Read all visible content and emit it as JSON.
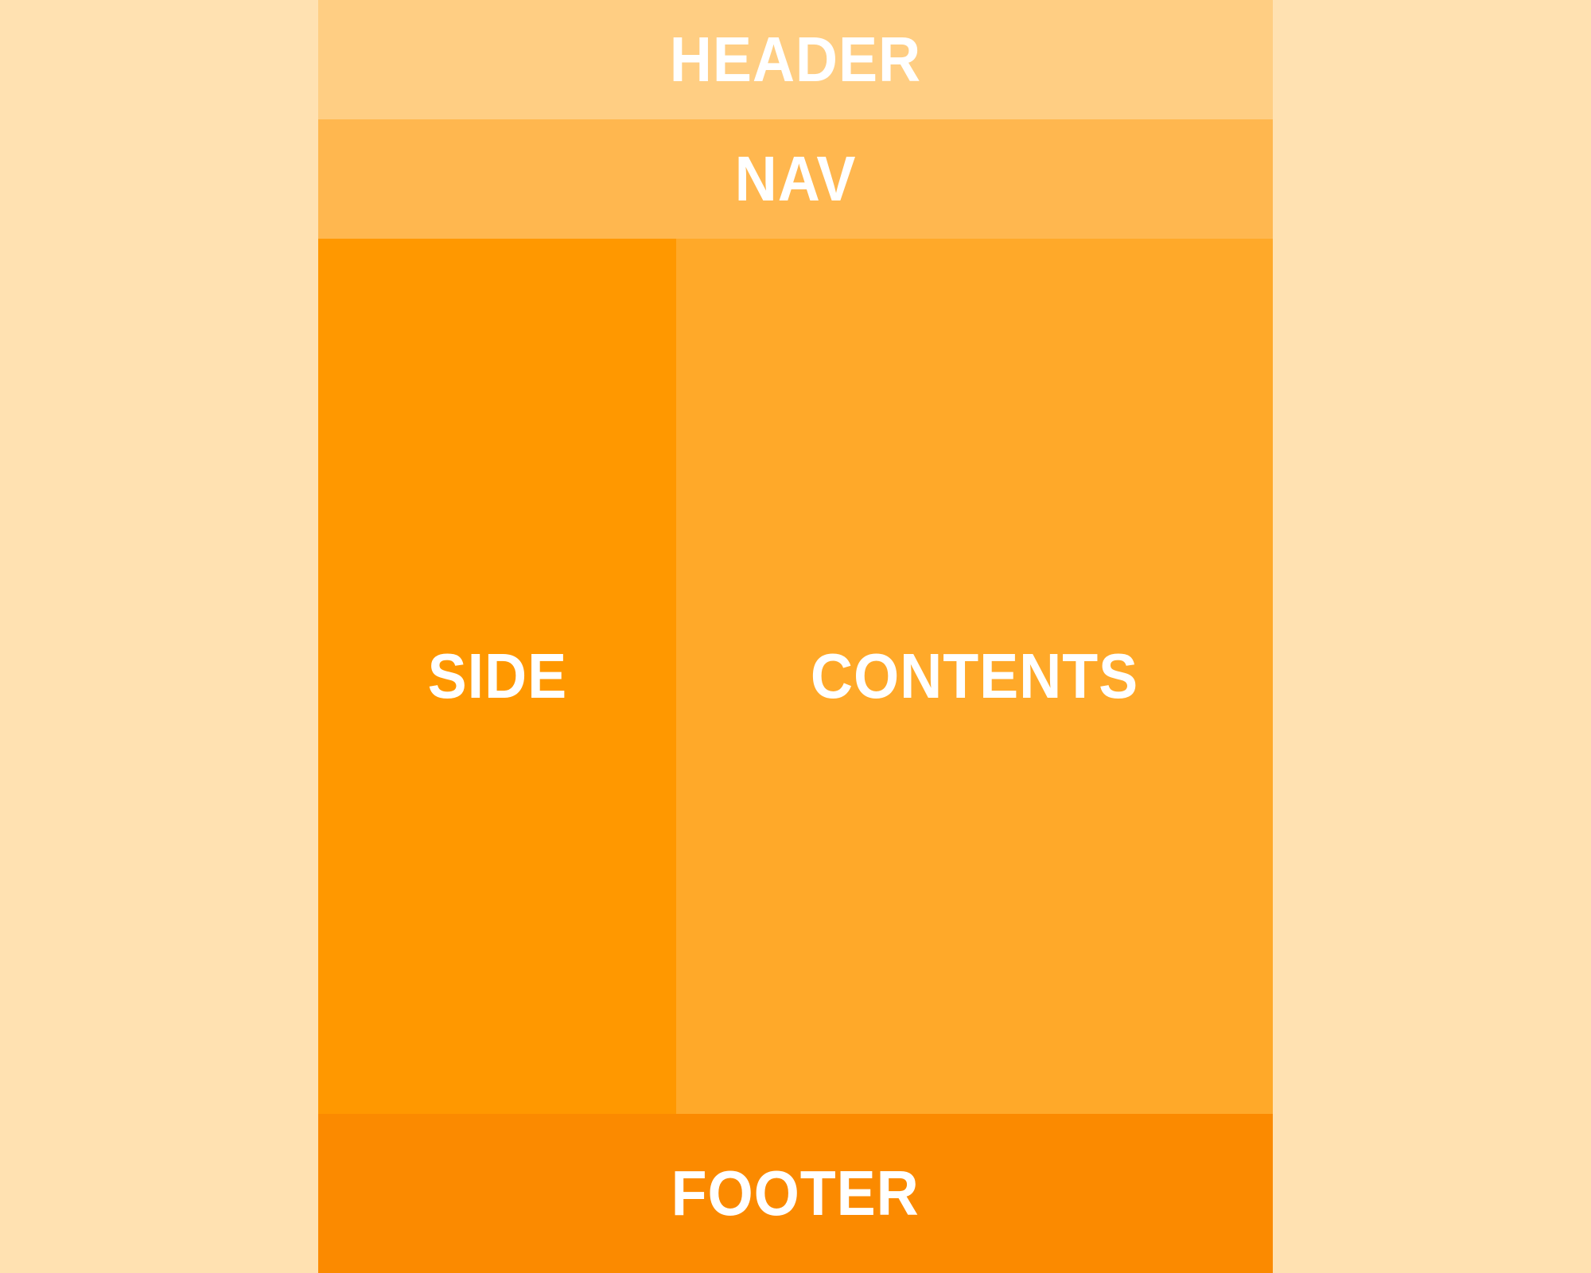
{
  "colors": {
    "background": "#FFE1B1",
    "header": "#FFCE83",
    "nav": "#FFB74F",
    "side": "#FF9800",
    "contents": "#FFA929",
    "footer": "#FB8A00",
    "label": "#FFFFFF"
  },
  "regions": {
    "header": {
      "label": "HEADER"
    },
    "nav": {
      "label": "NAV"
    },
    "side": {
      "label": "SIDE"
    },
    "contents": {
      "label": "CONTENTS"
    },
    "footer": {
      "label": "FOOTER"
    }
  }
}
